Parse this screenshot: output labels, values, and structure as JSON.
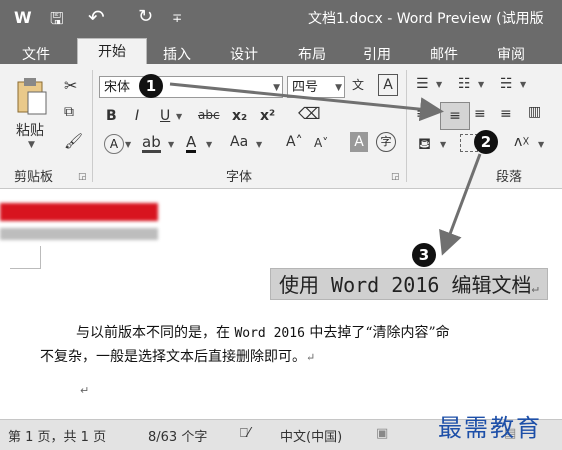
{
  "window": {
    "title": "文档1.docx - Word Preview (试用版",
    "quick_access": {
      "word_logo": "W",
      "save": "🖫",
      "undo": "↶",
      "redo": "↻",
      "customize": "∓"
    }
  },
  "tabs": [
    {
      "label": "文件"
    },
    {
      "label": "开始"
    },
    {
      "label": "插入"
    },
    {
      "label": "设计"
    },
    {
      "label": "布局"
    },
    {
      "label": "引用"
    },
    {
      "label": "邮件"
    },
    {
      "label": "审阅"
    }
  ],
  "ribbon": {
    "clipboard": {
      "paste_label": "粘贴",
      "group_label": "剪贴板"
    },
    "font": {
      "font_name": "宋体",
      "font_size": "四号",
      "buttons": {
        "bold": "B",
        "italic": "I",
        "underline": "U",
        "strike": "abc",
        "subscript": "x₂",
        "superscript": "x²",
        "font_color": "A",
        "change_case": "Aa",
        "grow": "A˄",
        "shrink": "A˅",
        "char_shading": "A",
        "enclose": "字",
        "phonetic": "文",
        "char_border": "A"
      },
      "group_label": "字体"
    },
    "paragraph": {
      "group_label": "段落"
    }
  },
  "annotations": [
    "1",
    "2",
    "3"
  ],
  "document": {
    "heading": "使用 Word 2016 编辑文档",
    "para_line1_a": "与以前版本不同的是，在 ",
    "para_line1_b": "Word 2016",
    "para_line1_c": " 中去掉了“清除内容”命",
    "para_line2": "不复杂，一般是选择文本后直接删除即可。",
    "para_mark": "↵"
  },
  "status": {
    "page": "第 1 页，共 1 页",
    "words": "8/63 个字",
    "language": "中文(中国)"
  },
  "watermark": "最需教育",
  "colors": {
    "titlebar": "#6b6b6b",
    "ribbon": "#f2f2f2",
    "arrow": "#707070",
    "watermark": "#1d4fa8",
    "red_band": "#d8141f"
  }
}
